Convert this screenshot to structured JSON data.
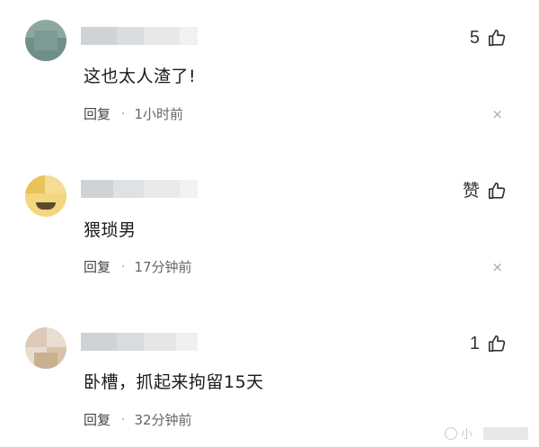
{
  "comments": [
    {
      "like_label": "5",
      "content": "这也太人渣了!",
      "reply_label": "回复",
      "separator": "·",
      "time": "1小时前",
      "close_glyph": "×"
    },
    {
      "like_label": "赞",
      "content": "猥琐男",
      "reply_label": "回复",
      "separator": "·",
      "time": "17分钟前",
      "close_glyph": "×"
    },
    {
      "like_label": "1",
      "content": "卧槽，抓起来拘留15天",
      "reply_label": "回复",
      "separator": "·",
      "time": "32分钟前",
      "close_glyph": "×"
    }
  ],
  "icons": {
    "like": "thumbs-up-icon"
  },
  "watermark": {
    "text": "小"
  }
}
